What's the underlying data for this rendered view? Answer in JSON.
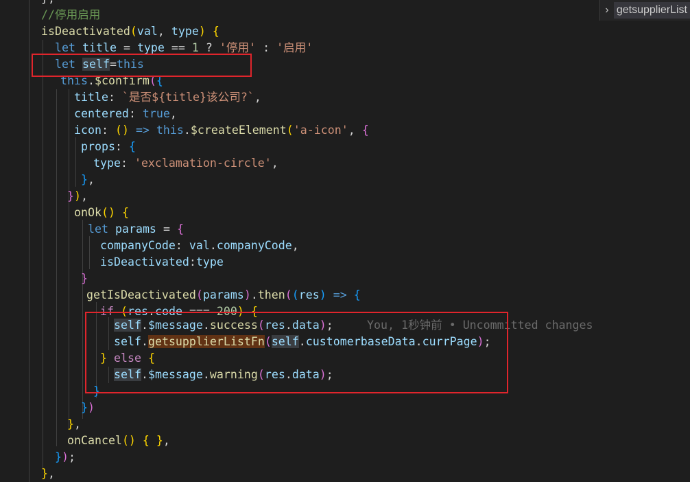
{
  "sticky_scroll": {
    "chevron": "chevron-right-icon",
    "label": "getsupplierList"
  },
  "code": {
    "top_fragment": "},",
    "comment": "//停用启用",
    "l1": {
      "name": "isDeactivated",
      "p1": "val",
      "p2": "type"
    },
    "l2": {
      "kw": "let",
      "name": "title",
      "eq": "=",
      "cmp_var": "type",
      "op": "==",
      "num": "1",
      "q": "?",
      "s1": "'停用'",
      "colon": ":",
      "s2": "'启用'"
    },
    "l3": {
      "kw": "let",
      "name": "self",
      "eq": "=",
      "val": "this"
    },
    "l4": {
      "obj": "this",
      "fn": "$confirm"
    },
    "l5": {
      "key": "title",
      "str": "`是否${title}该公司?`"
    },
    "l6": {
      "key": "centered",
      "val": "true"
    },
    "l7": {
      "key": "icon",
      "arrow": "=>",
      "obj": "this",
      "fn": "$createElement",
      "str": "'a-icon'"
    },
    "l8": {
      "key": "props"
    },
    "l9": {
      "key": "type",
      "str": "'exclamation-circle'"
    },
    "l12": {
      "fn": "onOk"
    },
    "l13": {
      "kw": "let",
      "name": "params",
      "eq": "="
    },
    "l14": {
      "key": "companyCode",
      "obj": "val",
      "prop": "companyCode"
    },
    "l15": {
      "key": "isDeactivated",
      "val": "type"
    },
    "l17": {
      "fn": "getIsDeactivated",
      "arg": "params",
      "then": "then",
      "res": "res",
      "arrow": "=>"
    },
    "l18": {
      "kw": "if",
      "obj": "res",
      "prop": "code",
      "op": "===",
      "num": "200"
    },
    "l19": {
      "self": "self",
      "msg": "$message",
      "fn": "success",
      "obj": "res",
      "prop": "data"
    },
    "l20": {
      "self": "self",
      "fn": "getsupplierListFn",
      "self2": "self",
      "obj": "customerbaseData",
      "prop": "currPage"
    },
    "l21": {
      "kw": "else"
    },
    "l22": {
      "self": "self",
      "msg": "$message",
      "fn": "warning",
      "obj": "res",
      "prop": "data"
    },
    "l26": {
      "fn": "onCancel"
    }
  },
  "blame": "You, 1秒钟前 • Uncommitted changes"
}
